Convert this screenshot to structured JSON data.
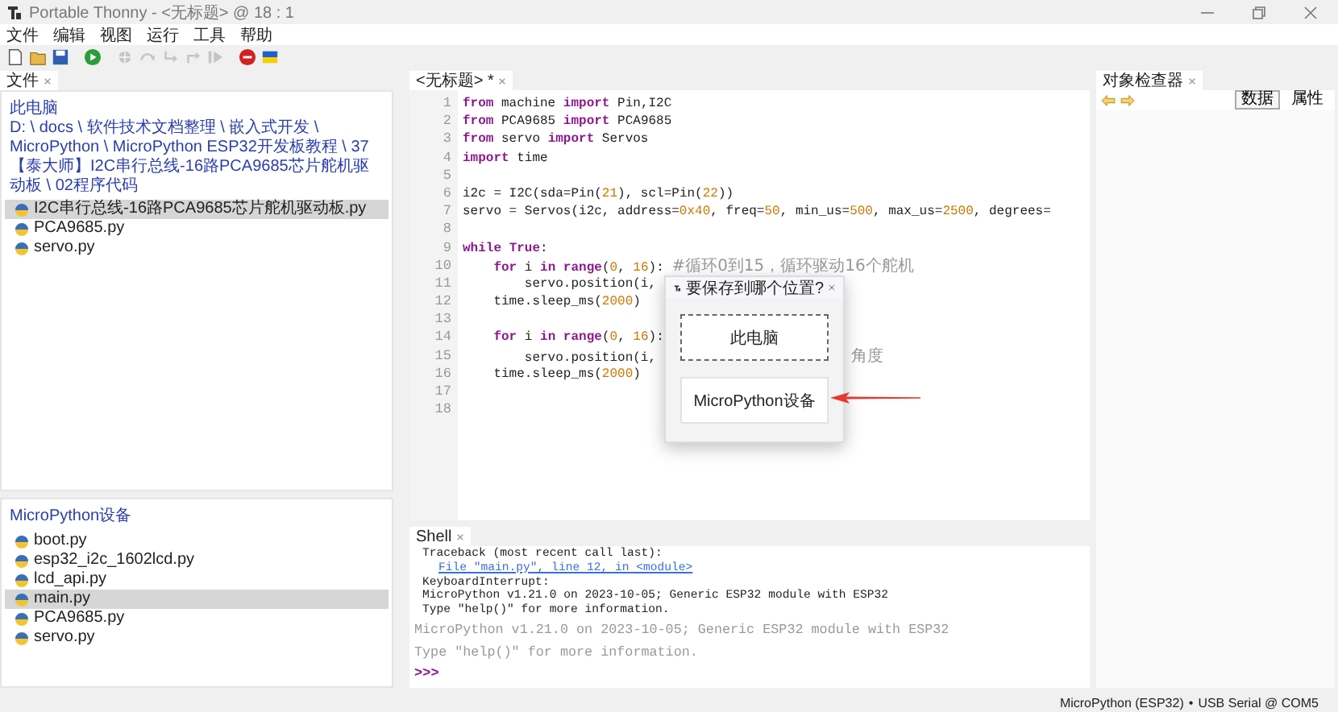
{
  "window": {
    "title": "Portable Thonny  -  <无标题>  @  18 : 1"
  },
  "menu": [
    "文件",
    "编辑",
    "视图",
    "运行",
    "工具",
    "帮助"
  ],
  "toolbar": [
    {
      "kind": "new",
      "disabled": false
    },
    {
      "kind": "open",
      "disabled": false
    },
    {
      "kind": "save",
      "disabled": false
    },
    {
      "kind": "run",
      "disabled": false
    },
    {
      "kind": "debug",
      "disabled": true
    },
    {
      "kind": "step-over",
      "disabled": true
    },
    {
      "kind": "step-into",
      "disabled": true
    },
    {
      "kind": "step-out",
      "disabled": true
    },
    {
      "kind": "resume",
      "disabled": true
    },
    {
      "kind": "stop",
      "disabled": false
    },
    {
      "kind": "flag",
      "disabled": false
    }
  ],
  "files_panel": {
    "tab": "文件",
    "location": "此电脑",
    "path": "D: \\ docs \\ 软件技术文档整理 \\ 嵌入式开发 \\ MicroPython \\ MicroPython ESP32开发板教程 \\ 37【泰大师】I2C串行总线-16路PCA9685芯片舵机驱动板 \\ 02程序代码",
    "files": [
      {
        "name": "I2C串行总线-16路PCA9685芯片舵机驱动板.py",
        "selected": true
      },
      {
        "name": "PCA9685.py",
        "selected": false
      },
      {
        "name": "servo.py",
        "selected": false
      }
    ]
  },
  "device_panel": {
    "title": "MicroPython设备",
    "files": [
      {
        "name": "boot.py",
        "selected": false
      },
      {
        "name": "esp32_i2c_1602lcd.py",
        "selected": false
      },
      {
        "name": "lcd_api.py",
        "selected": false
      },
      {
        "name": "main.py",
        "selected": true
      },
      {
        "name": "PCA9685.py",
        "selected": false
      },
      {
        "name": "servo.py",
        "selected": false
      }
    ]
  },
  "editor": {
    "tab": "<无标题> *",
    "lines": [
      {
        "number": "1",
        "tokens": [
          {
            "kind": "keyword",
            "text": "from"
          },
          {
            "kind": "plain",
            "text": " machine "
          },
          {
            "kind": "keyword",
            "text": "import"
          },
          {
            "kind": "plain",
            "text": " Pin,I2C"
          }
        ]
      },
      {
        "number": "2",
        "tokens": [
          {
            "kind": "keyword",
            "text": "from"
          },
          {
            "kind": "plain",
            "text": " PCA9685 "
          },
          {
            "kind": "keyword",
            "text": "import"
          },
          {
            "kind": "plain",
            "text": " PCA9685"
          }
        ]
      },
      {
        "number": "3",
        "tokens": [
          {
            "kind": "keyword",
            "text": "from"
          },
          {
            "kind": "plain",
            "text": " servo "
          },
          {
            "kind": "keyword",
            "text": "import"
          },
          {
            "kind": "plain",
            "text": " Servos"
          }
        ]
      },
      {
        "number": "4",
        "tokens": [
          {
            "kind": "keyword",
            "text": "import"
          },
          {
            "kind": "plain",
            "text": " time"
          }
        ]
      },
      {
        "number": "5"
      },
      {
        "number": "6",
        "tokens": [
          {
            "kind": "plain",
            "text": "i2c = I2C(sda=Pin("
          },
          {
            "kind": "number",
            "text": "21"
          },
          {
            "kind": "plain",
            "text": "), scl=Pin("
          },
          {
            "kind": "number",
            "text": "22"
          },
          {
            "kind": "plain",
            "text": "))"
          }
        ]
      },
      {
        "number": "7",
        "tokens": [
          {
            "kind": "plain",
            "text": "servo = Servos(i2c, address="
          },
          {
            "kind": "number",
            "text": "0x40"
          },
          {
            "kind": "plain",
            "text": ", freq="
          },
          {
            "kind": "number",
            "text": "50"
          },
          {
            "kind": "plain",
            "text": ", min_us="
          },
          {
            "kind": "number",
            "text": "500"
          },
          {
            "kind": "plain",
            "text": ", max_us="
          },
          {
            "kind": "number",
            "text": "2500"
          },
          {
            "kind": "plain",
            "text": ", degrees="
          }
        ]
      },
      {
        "number": "8"
      },
      {
        "number": "9",
        "tokens": [
          {
            "kind": "keyword",
            "text": "while"
          },
          {
            "kind": "keyword",
            "text": " True"
          },
          {
            "kind": "plain",
            "text": ":"
          }
        ]
      },
      {
        "number": "10",
        "tokens": [
          {
            "kind": "keyword",
            "text": "    for"
          },
          {
            "kind": "plain",
            "text": " i "
          },
          {
            "kind": "keyword",
            "text": "in"
          },
          {
            "kind": "keyword",
            "text": " range"
          },
          {
            "kind": "plain",
            "text": "("
          },
          {
            "kind": "number",
            "text": "0"
          },
          {
            "kind": "plain",
            "text": ", "
          },
          {
            "kind": "number",
            "text": "16"
          },
          {
            "kind": "plain",
            "text": "): "
          },
          {
            "kind": "comment",
            "text": "#循环0到15，循环驱动16个舵机"
          }
        ]
      },
      {
        "number": "11",
        "tokens": [
          {
            "kind": "plain",
            "text": "        servo.position(i, "
          }
        ]
      },
      {
        "number": "12",
        "tokens": [
          {
            "kind": "plain",
            "text": "    time.sleep_ms("
          },
          {
            "kind": "number",
            "text": "2000"
          },
          {
            "kind": "plain",
            "text": ")"
          }
        ]
      },
      {
        "number": "13"
      },
      {
        "number": "14",
        "tokens": [
          {
            "kind": "keyword",
            "text": "    for"
          },
          {
            "kind": "plain",
            "text": " i "
          },
          {
            "kind": "keyword",
            "text": "in"
          },
          {
            "kind": "keyword",
            "text": " range"
          },
          {
            "kind": "plain",
            "text": "("
          },
          {
            "kind": "number",
            "text": "0"
          },
          {
            "kind": "plain",
            "text": ", "
          },
          {
            "kind": "number",
            "text": "16"
          },
          {
            "kind": "plain",
            "text": "):"
          }
        ]
      },
      {
        "number": "15",
        "tokens": [
          {
            "kind": "plain",
            "text": "        servo.position(i, "
          },
          {
            "kind": "covered"
          },
          {
            "kind": "comment",
            "text": "角度"
          }
        ]
      },
      {
        "number": "16",
        "tokens": [
          {
            "kind": "plain",
            "text": "    time.sleep_ms("
          },
          {
            "kind": "number",
            "text": "2000"
          },
          {
            "kind": "plain",
            "text": ")"
          }
        ]
      },
      {
        "number": "17"
      },
      {
        "number": "18"
      }
    ]
  },
  "dialog": {
    "title": "要保存到哪个位置?",
    "buttons": [
      {
        "label": "此电脑",
        "selected": true
      },
      {
        "label": "MicroPython设备",
        "selected": false
      }
    ]
  },
  "shell": {
    "tab": "Shell",
    "lines": [
      {
        "kind": "output",
        "text": "Traceback (most recent call last):"
      },
      {
        "kind": "link",
        "text": "File \"main.py\", line 12, in <module>"
      },
      {
        "kind": "output",
        "text": "KeyboardInterrupt:"
      },
      {
        "kind": "output",
        "text": "MicroPython v1.21.0 on 2023-10-05; Generic ESP32 module with ESP32"
      },
      {
        "kind": "output",
        "text": "Type \"help()\" for more information."
      },
      {
        "kind": "banner",
        "text": "MicroPython v1.21.0 on 2023-10-05; Generic ESP32 module with ESP32"
      },
      {
        "kind": "banner",
        "text": "Type \"help()\" for more information."
      },
      {
        "kind": "prompt",
        "text": ">>>"
      }
    ]
  },
  "inspector": {
    "tab": "对象检查器",
    "buttons": [
      {
        "label": "数据",
        "selected": true
      },
      {
        "label": "属性",
        "selected": false
      }
    ]
  },
  "status_bar": {
    "interpreter": "MicroPython (ESP32)",
    "separator": "•",
    "port": "USB Serial @ COM5"
  }
}
